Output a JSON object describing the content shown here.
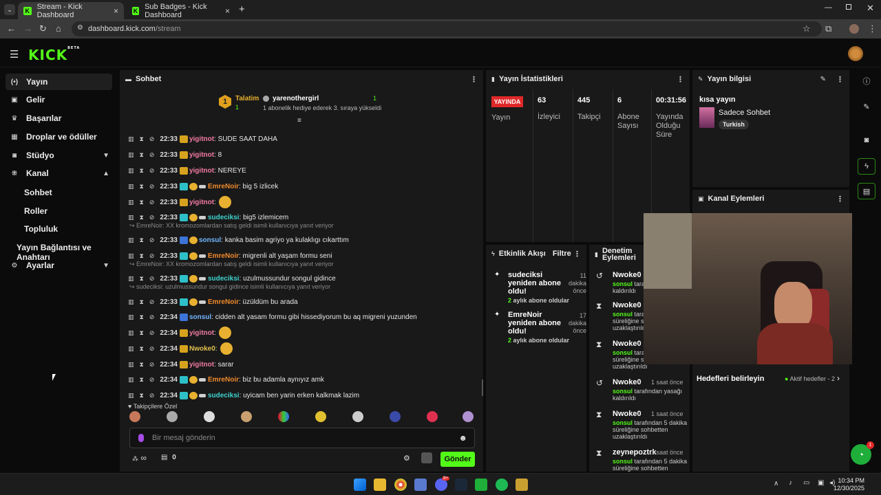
{
  "browser": {
    "tabs": [
      {
        "label": "Stream - Kick Dashboard",
        "active": true
      },
      {
        "label": "Sub Badges - Kick Dashboard",
        "active": false
      }
    ],
    "url_host": "dashboard.kick.com",
    "url_path": "/stream"
  },
  "app": {
    "logo": "KICK",
    "logo_tag": "BETA"
  },
  "sidebar": {
    "items": [
      {
        "label": "Yayın",
        "icon": "broadcast-icon"
      },
      {
        "label": "Gelir",
        "icon": "money-icon"
      },
      {
        "label": "Başarılar",
        "icon": "trophy-icon"
      },
      {
        "label": "Droplar ve ödüller",
        "icon": "gift-icon"
      },
      {
        "label": "Stüdyo",
        "icon": "studio-icon"
      },
      {
        "label": "Kanal",
        "icon": "channel-icon"
      },
      {
        "label": "Ayarlar",
        "icon": "gear-icon"
      }
    ],
    "kanal_sub": [
      "Sohbet",
      "Roller",
      "Topluluk",
      "Yayın Bağlantısı ve Anahtarı"
    ]
  },
  "chat": {
    "title": "Sohbet",
    "pinned": {
      "rank": "1",
      "leader_label": "Talatim",
      "leader_count": "1",
      "user": "yarenothergirl",
      "user_count": "1",
      "message": "1 abonelik hediye ederek 3. sıraya yükseldi"
    },
    "messages": [
      {
        "time": "22:33",
        "user": "yigitnot",
        "ucls": "u-y",
        "badges": [
          "crown"
        ],
        "text": ": SUDE SAAT DAHA"
      },
      {
        "time": "22:33",
        "user": "yigitnot",
        "ucls": "u-y",
        "badges": [
          "crown"
        ],
        "text": ": 8"
      },
      {
        "time": "22:33",
        "user": "yigitnot",
        "ucls": "u-y",
        "badges": [
          "crown"
        ],
        "text": ": NEREYE"
      },
      {
        "time": "22:33",
        "user": "EmreNoir",
        "ucls": "u-o",
        "badges": [
          "sub",
          "gift",
          "plane"
        ],
        "text": ": big 5 izlicek"
      },
      {
        "time": "22:33",
        "user": "yigitnot",
        "ucls": "u-y",
        "badges": [
          "crown"
        ],
        "text": ":"
      },
      {
        "time": "22:33",
        "user": "sudeciksi",
        "ucls": "u-t",
        "badges": [
          "sub",
          "gift",
          "plane"
        ],
        "text": ": big5 izlemicem"
      },
      {
        "time": "22:33",
        "user": "sonsul",
        "ucls": "u-b",
        "badges": [
          "blue",
          "gift"
        ],
        "text": ": kanka basim agriyo ya kulaklıgı cıkarttım"
      },
      {
        "time": "22:33",
        "user": "EmreNoir",
        "ucls": "u-o",
        "badges": [
          "sub",
          "gift",
          "plane"
        ],
        "text": ": migrenli alt yaşam formu seni"
      },
      {
        "time": "22:33",
        "user": "sudeciksi",
        "ucls": "u-t",
        "badges": [
          "sub",
          "gift",
          "plane"
        ],
        "text": ": uzulmussundur songul gidince"
      },
      {
        "time": "22:33",
        "user": "EmreNoir",
        "ucls": "u-o",
        "badges": [
          "sub",
          "gift",
          "plane"
        ],
        "text": ": üzüldüm bu arada"
      },
      {
        "time": "22:34",
        "user": "sonsul",
        "ucls": "u-b",
        "badges": [
          "blue"
        ],
        "text": ": cidden alt yasam formu gibi hissediyorum bu aq migreni yuzunden"
      },
      {
        "time": "22:34",
        "user": "yigitnot",
        "ucls": "u-y",
        "badges": [
          "crown"
        ],
        "text": ":"
      },
      {
        "time": "22:34",
        "user": "Nwoke0",
        "ucls": "u-g",
        "badges": [
          "crown"
        ],
        "text": ":"
      },
      {
        "time": "22:34",
        "user": "yigitnot",
        "ucls": "u-y",
        "badges": [
          "crown"
        ],
        "text": ": sarar"
      },
      {
        "time": "22:34",
        "user": "EmreNoir",
        "ucls": "u-o",
        "badges": [
          "sub",
          "gift",
          "plane"
        ],
        "text": ": biz bu adamla aynıyız amk"
      },
      {
        "time": "22:34",
        "user": "sudeciksi",
        "ucls": "u-t",
        "badges": [
          "sub",
          "gift",
          "plane"
        ],
        "text": ": uyicam ben yarin erken kalkmak lazim"
      }
    ],
    "replies": [
      "EmreNoir: XX kromozomlardan satış geldi isimli kullanıcıya yanıt veriyor",
      "EmreNoir: XX kromozomlardan satış geldi isimli kullanıcıya yanıt veriyor",
      "sudeciksi: uzulmussundur songul gidince isimli kullanıcıya yanıt veriyor"
    ],
    "followers_only": "Takipçilere Özel",
    "input_placeholder": "Bir mesaj gönderin",
    "infinity": "∞",
    "gift_count": "0",
    "send_label": "Gönder"
  },
  "stats": {
    "title": "Yayın İstatistikleri",
    "live_label": "YAYINDA",
    "yayin_label": "Yayın",
    "columns": [
      {
        "value": "63",
        "label": "İzleyici"
      },
      {
        "value": "445",
        "label": "Takipçi"
      },
      {
        "value": "6",
        "label": "Abone Sayısı"
      },
      {
        "value": "00:31:56",
        "label": "Yayında Olduğu Süre"
      }
    ]
  },
  "info": {
    "title": "Yayın bilgisi",
    "stream_title": "kısa yayın",
    "category": "Sadece Sohbet",
    "language": "Turkish"
  },
  "channel_actions": {
    "title": "Kanal Eylemleri"
  },
  "activity": {
    "title": "Etkinlik Akışı",
    "filter": "Filtre",
    "items": [
      {
        "title": "sudeciksi yeniden abone oldu!",
        "time": "11 dakika önce",
        "detail_num": "2",
        "detail": "aylık abone oldular"
      },
      {
        "title": "EmreNoir yeniden abone oldu!",
        "time": "17 dakika önce",
        "detail_num": "2",
        "detail": "aylık abone oldular"
      }
    ]
  },
  "moderation": {
    "title": "Denetim Eylemleri",
    "items": [
      {
        "name": "Nwoke0",
        "time": "",
        "actor": "sonsul",
        "text": "tarafından yasağı kaldırıldı",
        "icon": "undo-icon"
      },
      {
        "name": "Nwoke0",
        "time": "",
        "actor": "sonsul",
        "text": "tarafından 5 dakika süreliğine sohbetten uzaklaştırıldı",
        "icon": "hourglass-icon"
      },
      {
        "name": "Nwoke0",
        "time": "",
        "actor": "sonsul",
        "text": "tarafından 5 dakika süreliğine sohbetten uzaklaştırıldı",
        "icon": "hourglass-icon"
      },
      {
        "name": "Nwoke0",
        "time": "1 saat önce",
        "actor": "sonsul",
        "text": "tarafından yasağı kaldırıldı",
        "icon": "undo-icon"
      },
      {
        "name": "Nwoke0",
        "time": "1 saat önce",
        "actor": "sonsul",
        "text": "tarafından 5 dakika süreliğine sohbetten uzaklaştırıldı",
        "icon": "hourglass-icon"
      },
      {
        "name": "zeynepoztrk",
        "time": "1 saat önce",
        "actor": "sonsul",
        "text": "tarafından 5 dakika süreliğine sohbetten",
        "icon": "hourglass-icon"
      }
    ]
  },
  "goals": {
    "title": "Hedefleri belirleyin",
    "active": "Aktif hedefler - 2"
  },
  "support_badge": "1",
  "taskbar": {
    "time": "10:34 PM",
    "date": "12/30/2025",
    "discord_badge": "9+"
  },
  "colors": {
    "accent": "#53fc18",
    "panel": "#191919",
    "live": "#e02828"
  }
}
